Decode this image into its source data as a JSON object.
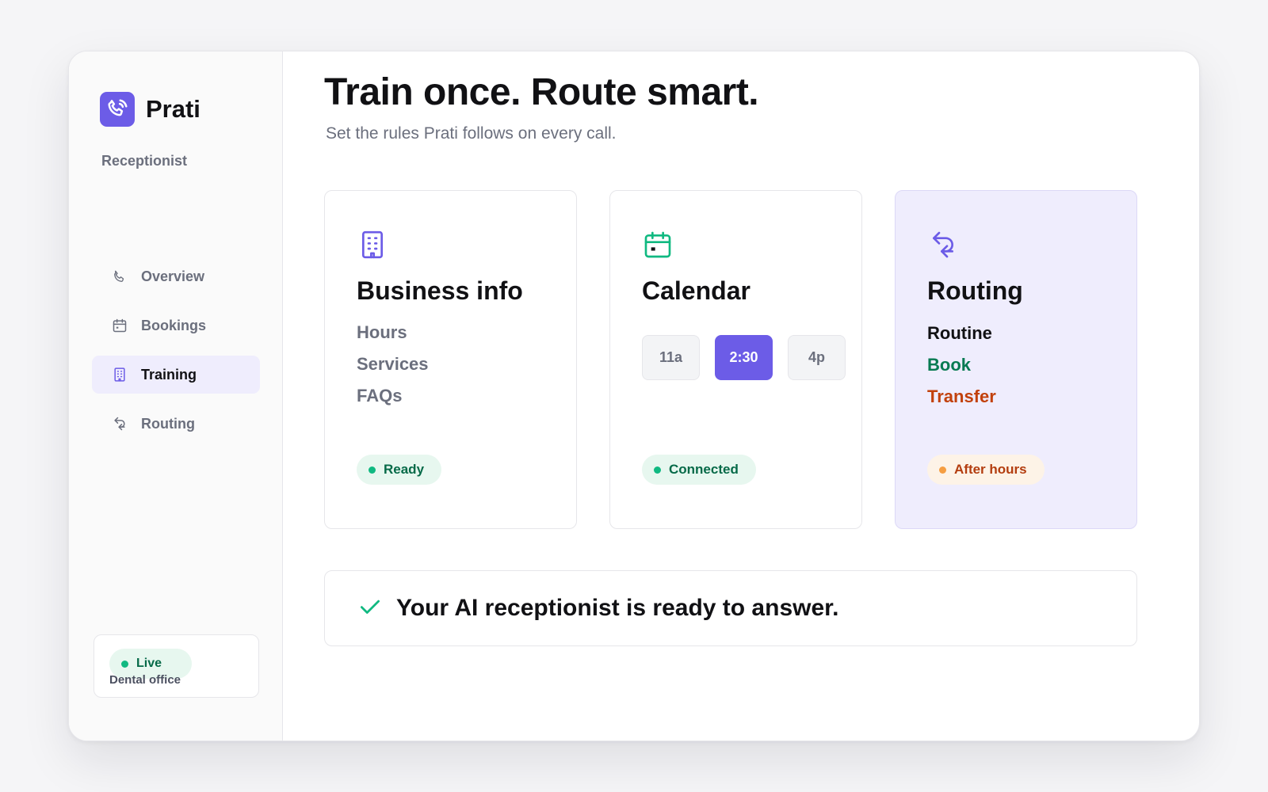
{
  "colors": {
    "accent": "#6c5ce7",
    "accent_soft": "#efedfd",
    "success": "#10b981",
    "success_text": "#066a48",
    "warning": "#f59e42",
    "warning_text": "#b33d0f",
    "muted_text": "#6b6f7d"
  },
  "sidebar": {
    "brand": {
      "name": "Prati",
      "icon": "phone-call-icon"
    },
    "section_label": "Receptionist",
    "nav": [
      {
        "label": "Overview",
        "icon": "phone-icon",
        "active": false
      },
      {
        "label": "Bookings",
        "icon": "calendar-icon",
        "active": false
      },
      {
        "label": "Training",
        "icon": "building-icon",
        "active": true
      },
      {
        "label": "Routing",
        "icon": "route-arrows-icon",
        "active": false
      }
    ],
    "status": {
      "badge": "Live",
      "subtitle": "Dental office"
    }
  },
  "main": {
    "title": "Train once. Route smart.",
    "subtitle": "Set the rules Prati follows on every call.",
    "cards": {
      "business": {
        "icon": "building-icon",
        "title": "Business info",
        "items": [
          "Hours",
          "Services",
          "FAQs"
        ],
        "status": "Ready"
      },
      "calendar": {
        "icon": "calendar-icon",
        "title": "Calendar",
        "slots": [
          "11a",
          "2:30",
          "4p"
        ],
        "selected_slot": "2:30",
        "status": "Connected"
      },
      "routing": {
        "icon": "route-arrows-icon",
        "title": "Routing",
        "items": [
          {
            "label": "Routine",
            "color": "#111114"
          },
          {
            "label": "Book",
            "color": "#077a52"
          },
          {
            "label": "Transfer",
            "color": "#c2410c"
          }
        ],
        "status": "After hours"
      }
    },
    "banner": {
      "icon": "check-icon",
      "text": "Your AI receptionist is ready to answer."
    }
  }
}
